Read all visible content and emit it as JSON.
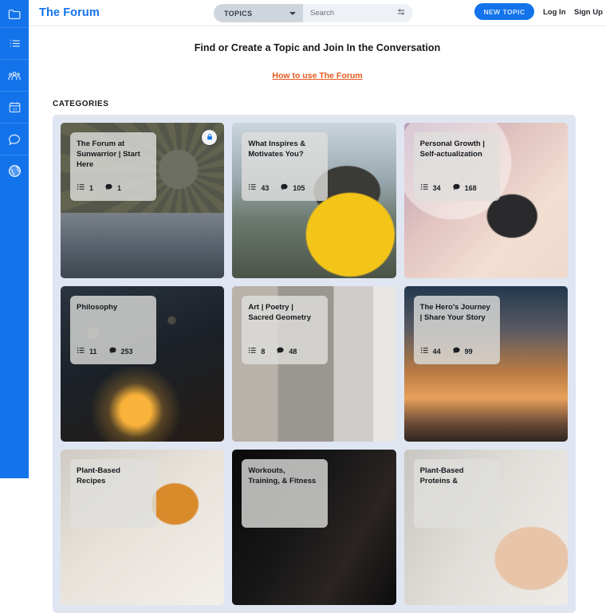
{
  "sidebar": {
    "logo_icon": "folder-icon",
    "items": [
      {
        "icon": "list-icon",
        "name": "sidebar-item-list"
      },
      {
        "icon": "people-icon",
        "name": "sidebar-item-members"
      },
      {
        "icon": "calendar-icon",
        "name": "sidebar-item-events",
        "day": "23"
      },
      {
        "icon": "chat-icon",
        "name": "sidebar-item-messages"
      },
      {
        "icon": "globe-icon",
        "name": "sidebar-item-explore"
      }
    ]
  },
  "header": {
    "brand": "The Forum",
    "category_filter": {
      "label": "TOPICS",
      "caret_icon": "chevron-down-icon"
    },
    "search": {
      "placeholder": "Search",
      "value": "",
      "filter_icon": "sliders-icon"
    },
    "new_topic_label": "NEW TOPIC",
    "login_label": "Log In",
    "signup_label": "Sign Up"
  },
  "main": {
    "tagline": "Find or Create a Topic and Join In the Conversation",
    "howto_link": "How to use The Forum",
    "categories_label": "CATEGORIES"
  },
  "cards": [
    {
      "title": "The Forum at\nSunwarrior | Start\nHere",
      "topics": "1",
      "posts": "1",
      "locked": true,
      "art": "bg-forum",
      "name": "category-card-forum-at-sunwarrior"
    },
    {
      "title": "What Inspires &\nMotivates You?",
      "topics": "43",
      "posts": "105",
      "locked": false,
      "art": "bg-inspire",
      "name": "category-card-what-inspires-motivates-you"
    },
    {
      "title": "Personal Growth |\nSelf-actualization",
      "topics": "34",
      "posts": "168",
      "locked": false,
      "art": "bg-growth",
      "name": "category-card-personal-growth"
    },
    {
      "title": "Philosophy",
      "topics": "11",
      "posts": "253",
      "locked": false,
      "art": "bg-philosophy",
      "name": "category-card-philosophy"
    },
    {
      "title": "Art | Poetry |\nSacred Geometry",
      "topics": "8",
      "posts": "48",
      "locked": false,
      "art": "bg-art",
      "name": "category-card-art-poetry-sacred-geometry"
    },
    {
      "title": "The Hero's Journey\n| Share Your Story",
      "topics": "44",
      "posts": "99",
      "locked": false,
      "art": "bg-hero",
      "name": "category-card-heros-journey"
    },
    {
      "title": "Plant-Based\nRecipes",
      "topics": "",
      "posts": "",
      "locked": false,
      "art": "bg-recipes",
      "name": "category-card-plant-based-recipes"
    },
    {
      "title": "Workouts,\nTraining, & Fitness",
      "topics": "",
      "posts": "",
      "locked": false,
      "art": "bg-workout",
      "name": "category-card-workouts-training-fitness"
    },
    {
      "title": "Plant-Based\nProteins &",
      "topics": "",
      "posts": "",
      "locked": false,
      "art": "bg-proteins",
      "name": "category-card-plant-based-proteins"
    }
  ],
  "icons": {
    "topics_stat": "list-icon",
    "posts_stat": "comment-icon",
    "lock": "lock-icon"
  },
  "colors": {
    "brand_blue": "#1273eb",
    "accent_orange": "#e8591e",
    "panel_bg": "#dfe6f1",
    "text_dark": "#15181c"
  }
}
